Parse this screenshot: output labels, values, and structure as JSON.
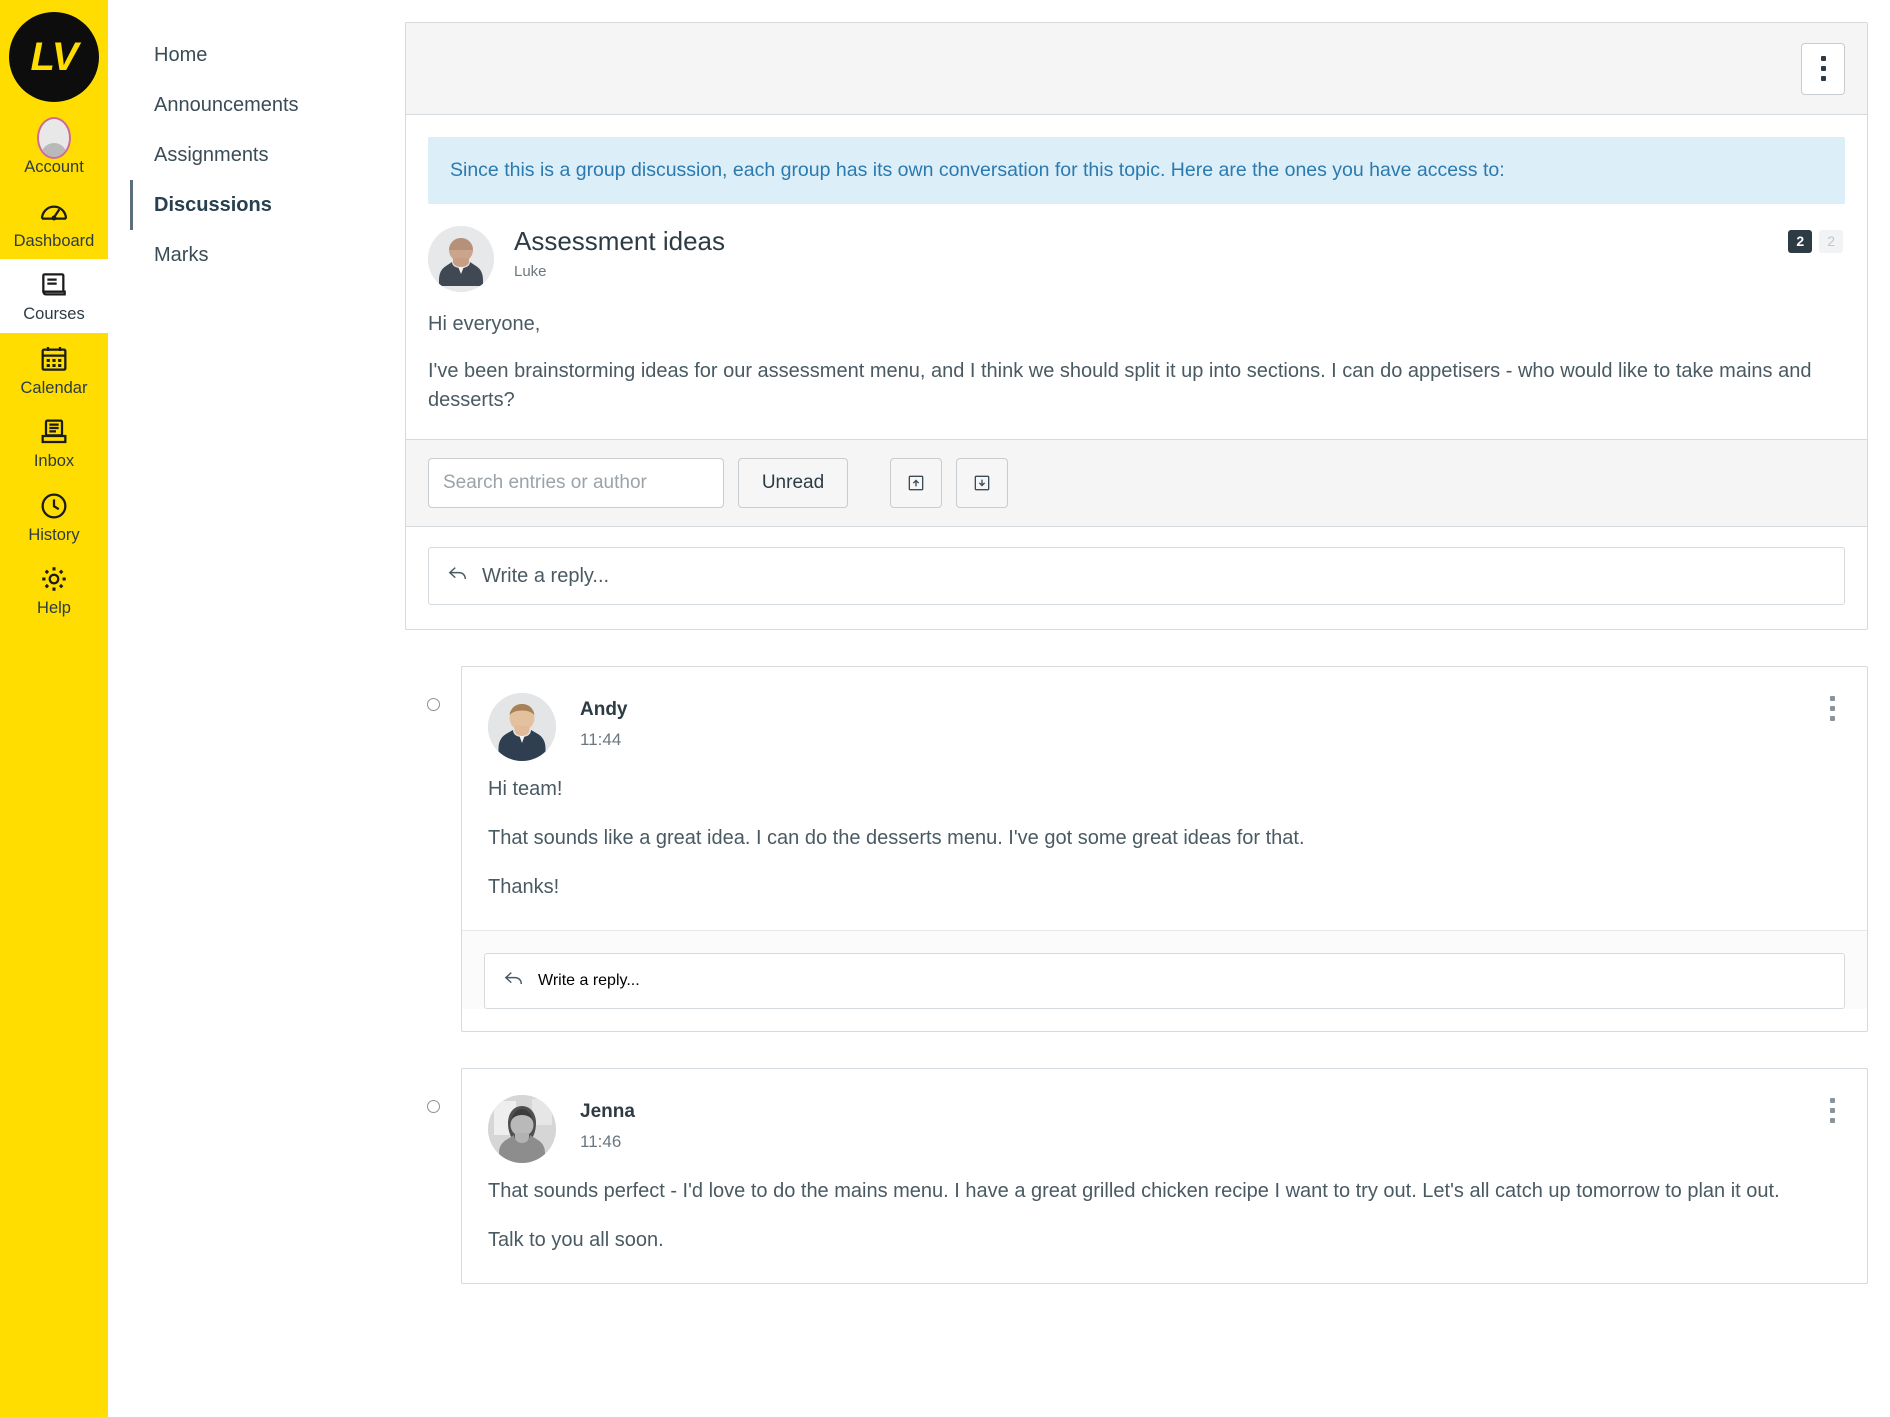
{
  "global_nav": {
    "logo_text": "LV",
    "items": [
      {
        "label": "Account",
        "icon": "user-avatar-icon",
        "active": false
      },
      {
        "label": "Dashboard",
        "icon": "gauge-icon",
        "active": false
      },
      {
        "label": "Courses",
        "icon": "book-icon",
        "active": true
      },
      {
        "label": "Calendar",
        "icon": "calendar-icon",
        "active": false
      },
      {
        "label": "Inbox",
        "icon": "inbox-tray-icon",
        "active": false
      },
      {
        "label": "History",
        "icon": "clock-icon",
        "active": false
      },
      {
        "label": "Help",
        "icon": "gear-icon",
        "active": false
      }
    ]
  },
  "course_nav": {
    "items": [
      {
        "label": "Home",
        "active": false
      },
      {
        "label": "Announcements",
        "active": false
      },
      {
        "label": "Assignments",
        "active": false
      },
      {
        "label": "Discussions",
        "active": true
      },
      {
        "label": "Marks",
        "active": false
      }
    ]
  },
  "topic": {
    "notice": "Since this is a group discussion, each group has its own conversation for this topic. Here are the ones you have access to:",
    "title": "Assessment ideas",
    "author": "Luke",
    "badge_unread": "2",
    "badge_total": "2",
    "paragraphs": [
      "Hi everyone,",
      "I've been brainstorming ideas for our assessment menu, and I think we should split it up into sections.  I can do appetisers - who would like to take mains and desserts?"
    ],
    "kebab_label": "more-options"
  },
  "filter_bar": {
    "search_placeholder": "Search entries or author",
    "search_value": "",
    "unread_label": "Unread",
    "collapse_icon": "collapse-up-icon",
    "expand_icon": "expand-down-icon"
  },
  "reply_prompt": "Write a reply...",
  "entries": [
    {
      "author": "Andy",
      "time": "11:44",
      "unread": true,
      "avatar": "andy-photo",
      "paragraphs": [
        "Hi team!",
        "That sounds like a great idea.  I can do the desserts menu. I've got some great ideas for that.",
        "Thanks!"
      ],
      "reply_prompt": "Write a reply...",
      "has_reply_box": true
    },
    {
      "author": "Jenna",
      "time": "11:46",
      "unread": true,
      "avatar": "jenna-photo",
      "paragraphs": [
        "That sounds perfect - I'd love to do the mains menu. I have a great grilled chicken recipe I want to try out.  Let's all catch up tomorrow to plan it out.",
        "Talk to you all soon."
      ],
      "reply_prompt": "Write a reply...",
      "has_reply_box": false
    }
  ],
  "colors": {
    "brand_yellow": "#FFDD00",
    "notice_bg": "#DCEEF8",
    "notice_text": "#2A7AB0",
    "text_primary": "#2D3B45",
    "text_body": "#4A5A63",
    "border": "#D5DADE"
  }
}
